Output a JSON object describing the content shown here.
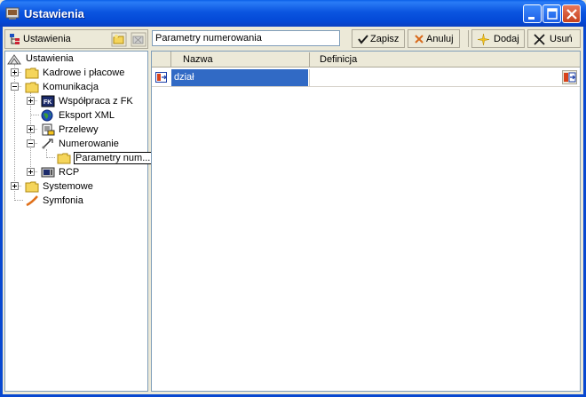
{
  "window": {
    "title": "Ustawienia"
  },
  "toolbar": {
    "tree_label": "Ustawienia",
    "path_value": "Parametry numerowania",
    "save_label": "Zapisz",
    "cancel_label": "Anuluj",
    "add_label": "Dodaj",
    "delete_label": "Usuń"
  },
  "tree": {
    "items": [
      {
        "label": "Ustawienia",
        "icon": "settings-root-icon"
      },
      {
        "label": "Kadrowe i płacowe",
        "icon": "folder-icon"
      },
      {
        "label": "Komunikacja",
        "icon": "folder-icon"
      },
      {
        "label": "Współpraca z FK",
        "icon": "fk-icon"
      },
      {
        "label": "Eksport XML",
        "icon": "globe-icon"
      },
      {
        "label": "Przelewy",
        "icon": "transfer-icon"
      },
      {
        "label": "Numerowanie",
        "icon": "numbering-icon"
      },
      {
        "label": "Parametry num...",
        "icon": "folder-icon"
      },
      {
        "label": "RCP",
        "icon": "rcp-icon"
      },
      {
        "label": "Systemowe",
        "icon": "folder-icon"
      },
      {
        "label": "Symfonia",
        "icon": "symfonia-icon"
      }
    ]
  },
  "grid": {
    "columns": [
      "Nazwa",
      "Definicja"
    ],
    "rows": [
      {
        "name": "dział",
        "definition": ""
      }
    ]
  }
}
